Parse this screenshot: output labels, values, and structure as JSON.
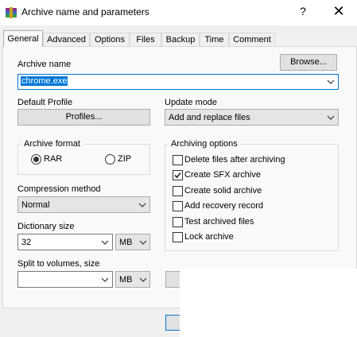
{
  "window": {
    "title": "Archive name and parameters",
    "help": "?",
    "close": "✕"
  },
  "tabs": [
    "General",
    "Advanced",
    "Options",
    "Files",
    "Backup",
    "Time",
    "Comment"
  ],
  "archive_name": {
    "label": "Archive name",
    "value": "chrome.exe",
    "browse_label": "Browse..."
  },
  "default_profile": {
    "label": "Default Profile",
    "button_label": "Profiles..."
  },
  "update_mode": {
    "label": "Update mode",
    "value": "Add and replace files"
  },
  "archive_format": {
    "label": "Archive format",
    "options": [
      "RAR",
      "ZIP"
    ],
    "selected": "RAR"
  },
  "compression_method": {
    "label": "Compression method",
    "value": "Normal"
  },
  "dictionary_size": {
    "label": "Dictionary size",
    "value": "32",
    "unit": "MB"
  },
  "split_volumes": {
    "label": "Split to volumes, size",
    "value": "",
    "unit": "MB"
  },
  "archiving_options": {
    "label": "Archiving options",
    "items": [
      {
        "label": "Delete files after archiving",
        "checked": false
      },
      {
        "label": "Create SFX archive",
        "checked": true
      },
      {
        "label": "Create solid archive",
        "checked": false
      },
      {
        "label": "Add recovery record",
        "checked": false
      },
      {
        "label": "Test archived files",
        "checked": false
      },
      {
        "label": "Lock archive",
        "checked": false
      }
    ]
  },
  "colors": {
    "selection": "#0078d7",
    "focus_border": "#0078d7",
    "panel": "#f9f9f9",
    "window": "#f0f0f0"
  }
}
